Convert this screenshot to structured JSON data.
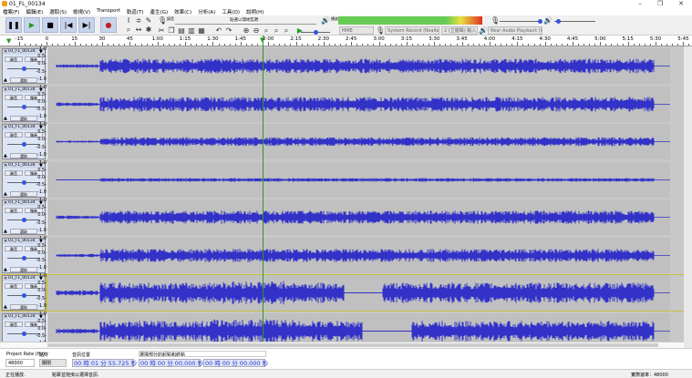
{
  "window": {
    "title": "01_FL_00134",
    "minimize": "–",
    "maximize": "❐",
    "close": "✕"
  },
  "menu": [
    "檔案(F)",
    "編輯(E)",
    "選取(S)",
    "檢視(V)",
    "Transport",
    "軌道(T)",
    "產生(G)",
    "效果(C)",
    "分析(A)",
    "工具(O)",
    "說明(H)"
  ],
  "transport": {
    "pause": "❚❚",
    "play": "▶",
    "stop": "■",
    "skip_start": "|◀",
    "skip_end": "▶|",
    "record": "●"
  },
  "meters": {
    "record_label": "錄音",
    "playback_label": "播放",
    "monitor_hint": "點選以開始監聽",
    "meter_ticks": [
      "-54",
      "-48",
      "-42",
      "-36",
      "-30",
      "-24",
      "-18",
      "-12",
      "-6",
      "0"
    ]
  },
  "devices": {
    "host": "MME",
    "input": "System Record (Realtek",
    "channels": "2 (立體聲) 輸入",
    "output": "Rear Audio Playback (R"
  },
  "ruler": {
    "ticks": [
      "-15",
      "0",
      "15",
      "30",
      "45",
      "1:00",
      "1:15",
      "1:30",
      "1:45",
      "2:00",
      "2:15",
      "2:30",
      "2:45",
      "3:00",
      "3:15",
      "3:30",
      "3:45",
      "4:00",
      "4:15",
      "4:30",
      "4:45",
      "5:00",
      "5:15",
      "5:30",
      "5:45"
    ]
  },
  "playhead_time": "1:55.725",
  "tracks": [
    {
      "name": "01_FL_00134",
      "mute": "靜音",
      "solo": "獨奏",
      "select": "選取",
      "selected": false
    },
    {
      "name": "01_FL_00134",
      "mute": "靜音",
      "solo": "獨奏",
      "select": "選取",
      "selected": false
    },
    {
      "name": "01_FL_00134",
      "mute": "靜音",
      "solo": "獨奏",
      "select": "選取",
      "selected": false
    },
    {
      "name": "01_FL_00134",
      "mute": "靜音",
      "solo": "獨奏",
      "select": "選取",
      "selected": false
    },
    {
      "name": "01_FL_00134",
      "mute": "靜音",
      "solo": "獨奏",
      "select": "選取",
      "selected": false
    },
    {
      "name": "01_FL_00134",
      "mute": "靜音",
      "solo": "獨奏",
      "select": "選取",
      "selected": false
    },
    {
      "name": "01_FL_00134",
      "mute": "靜音",
      "solo": "獨奏",
      "select": "選取",
      "selected": true
    },
    {
      "name": "01_FL_00134",
      "mute": "靜音",
      "solo": "獨奏",
      "select": "選取",
      "selected": false
    }
  ],
  "yscale": [
    "1.0",
    "0.5-",
    "0.0-",
    "-0.5-",
    "-1.0"
  ],
  "selection_toolbar": {
    "rate_label": "Project Rate (Hz)",
    "rate_value": "48000",
    "snap_label": "貼齊",
    "snap_value": "關閉",
    "position_label": "音訊位置",
    "position_value": "00 時 01 分 55.725 秒",
    "range_label": "選擇部分的起點和終點",
    "start_value": "00 時 00 分 00.000 秒",
    "end_value": "00 時 00 分 00.000 秒"
  },
  "status": {
    "state": "正在播放.",
    "hint": "點擊並拖曳以選擇音訊.",
    "rate": "實際速率：48000"
  },
  "colors": {
    "waveform": "#3232c8",
    "playhead": "#2a9a2a",
    "meter_green": "#66cc55"
  }
}
